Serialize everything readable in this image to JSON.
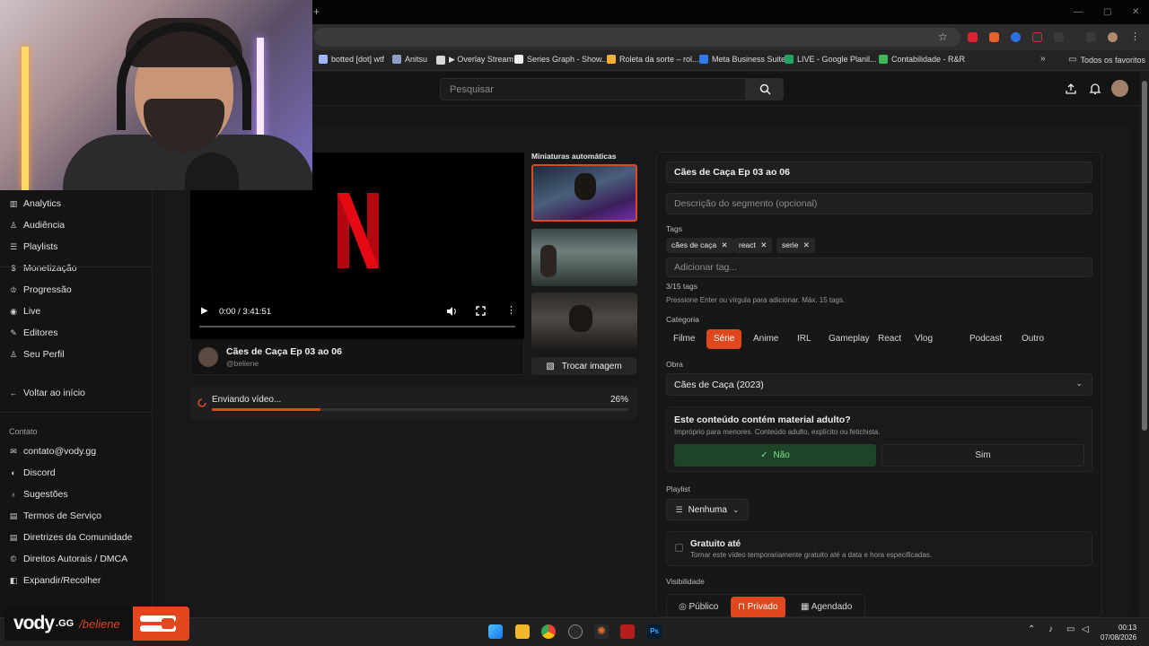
{
  "browser": {
    "bookmarks": [
      {
        "label": "botted [dot] wtf",
        "icon": "bot-icon",
        "color": "#9fb3ff"
      },
      {
        "label": "Anitsu",
        "icon": "alien-icon",
        "color": "#8aa0c8"
      },
      {
        "label": "▶ Overlay Stream",
        "icon": "github-icon",
        "color": "#d8d8d8"
      },
      {
        "label": "Series Graph - Show...",
        "icon": "s-icon",
        "color": "#eeeeee"
      },
      {
        "label": "Roleta da sorte – rol...",
        "icon": "wheel-icon",
        "color": "#f2b134"
      },
      {
        "label": "Meta Business Suite",
        "icon": "meta-icon",
        "color": "#2e7bf6"
      },
      {
        "label": "LIVE - Google Planil...",
        "icon": "sheets-icon",
        "color": "#21a464"
      },
      {
        "label": "Contabilidade - R&R",
        "icon": "leaf-icon",
        "color": "#3dbb5b"
      }
    ],
    "all_bookmarks": "Todos os favoritos"
  },
  "header": {
    "search_placeholder": "Pesquisar"
  },
  "sidebar": {
    "items": [
      {
        "label": "Analytics",
        "icon": "analytics-icon",
        "glyph": "▥"
      },
      {
        "label": "Audiência",
        "icon": "audience-icon",
        "glyph": "♙"
      },
      {
        "label": "Playlists",
        "icon": "playlist-icon",
        "glyph": "☰"
      },
      {
        "label": "Monetização",
        "icon": "money-icon",
        "glyph": "$"
      },
      {
        "label": "Progressão",
        "icon": "trophy-icon",
        "glyph": "♔"
      },
      {
        "label": "Live",
        "icon": "live-icon",
        "glyph": "◉"
      },
      {
        "label": "Editores",
        "icon": "editors-icon",
        "glyph": "✎"
      },
      {
        "label": "Seu Perfil",
        "icon": "profile-icon",
        "glyph": "♙"
      }
    ],
    "back": "Voltar ao início",
    "contact_title": "Contato",
    "contact_items": [
      {
        "label": "contato@vody.gg",
        "icon": "mail-icon",
        "glyph": "✉"
      },
      {
        "label": "Discord",
        "icon": "discord-icon",
        "glyph": "◐"
      },
      {
        "label": "Sugestões",
        "icon": "idea-icon",
        "glyph": "♁"
      },
      {
        "label": "Termos de Serviço",
        "icon": "terms-icon",
        "glyph": "▤"
      },
      {
        "label": "Diretrizes da Comunidade",
        "icon": "guidelines-icon",
        "glyph": "▤"
      },
      {
        "label": "Direitos Autorais / DMCA",
        "icon": "copyright-icon",
        "glyph": "©"
      },
      {
        "label": "Expandir/Recolher",
        "icon": "collapse-icon",
        "glyph": "◧"
      }
    ]
  },
  "player": {
    "time": "0:00 / 3:41:51",
    "video_title": "Cães de Caça Ep 03 ao 06",
    "channel": "@beliene"
  },
  "upload": {
    "status": "Enviando vídeo...",
    "percent_label": "26%",
    "progress": 0.26
  },
  "thumbnails": {
    "title": "Miniaturas automáticas",
    "swap_label": "Trocar imagem",
    "selected_index": 0
  },
  "form": {
    "title_value": "Cães de Caça Ep 03 ao 06",
    "description_placeholder": "Descrição do segmento (opcional)",
    "tags_label": "Tags",
    "tags": [
      "cães de caça",
      "react",
      "serie"
    ],
    "tag_input_placeholder": "Adicionar tag...",
    "tag_count": "3/15 tags",
    "tag_hint": "Pressione Enter ou vírgula para adicionar. Máx. 15 tags.",
    "category_label": "Categoria",
    "categories": [
      "Filme",
      "Série",
      "Anime",
      "IRL",
      "Gameplay",
      "React",
      "Vlog",
      "Podcast",
      "Outro"
    ],
    "selected_category": "Série",
    "work_label": "Obra",
    "work_value": "Cães de Caça (2023)",
    "adult_title": "Este conteúdo contém material adulto?",
    "adult_desc": "Impróprio para menores. Conteúdo adulto, explícito ou fetichista.",
    "adult_no": "Não",
    "adult_yes": "Sim",
    "playlist_label": "Playlist",
    "playlist_value": "Nenhuma",
    "free_title": "Gratuito até",
    "free_desc": "Tornar este vídeo temporariamente gratuito até a data e hora especificadas.",
    "visibility_label": "Visibilidade",
    "visibility_options": [
      "Público",
      "Privado",
      "Agendado"
    ],
    "selected_visibility": "Privado"
  },
  "overlay": {
    "brand": "vody",
    "brand_suffix": ".GG",
    "channel": "/beliene"
  },
  "taskbar": {
    "time": "00:13",
    "date": "07/08/2026"
  },
  "colors": {
    "accent": "#e1471c",
    "success": "#1d4427",
    "netflix_red": "#e50914"
  }
}
